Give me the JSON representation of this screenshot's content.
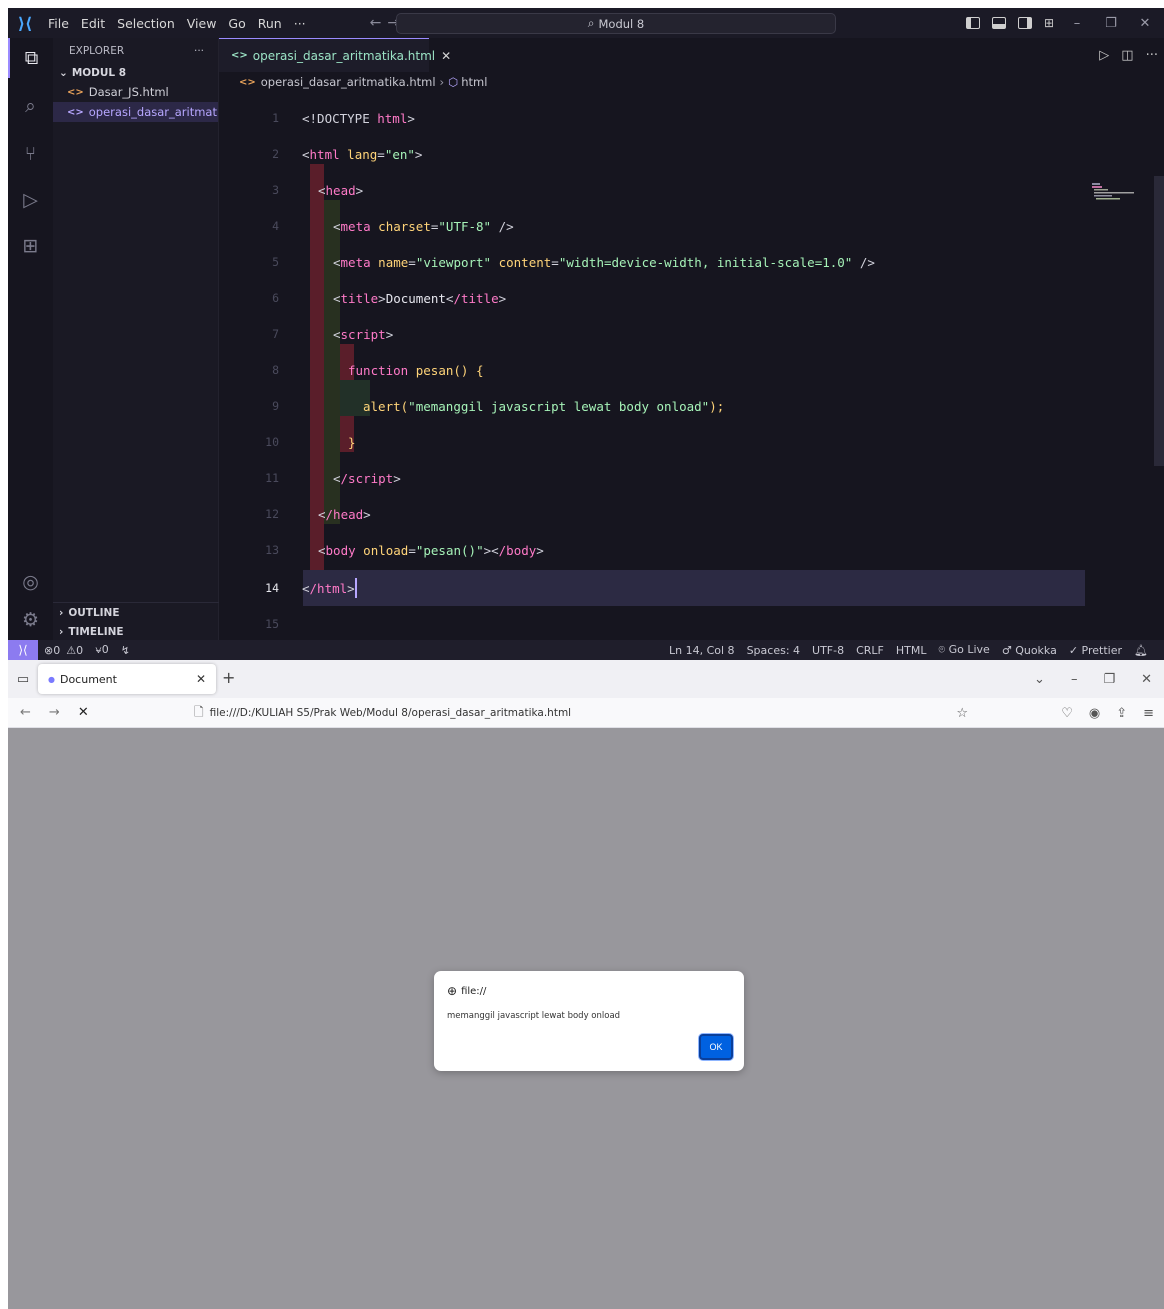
{
  "vscode": {
    "menu": [
      "File",
      "Edit",
      "Selection",
      "View",
      "Go",
      "Run",
      "···"
    ],
    "command_center": "Modul 8",
    "explorer": {
      "title": "EXPLORER",
      "more": "···",
      "folder": "MODUL 8",
      "files": [
        "Dasar_JS.html",
        "operasi_dasar_aritmatik..."
      ],
      "outline": "OUTLINE",
      "timeline": "TIMELINE"
    },
    "tab": {
      "label": "operasi_dasar_aritmatika.html"
    },
    "breadcrumb": {
      "file": "operasi_dasar_aritmatika.html",
      "symbol": "html"
    },
    "line_numbers": [
      "1",
      "2",
      "3",
      "4",
      "5",
      "6",
      "7",
      "8",
      "9",
      "10",
      "11",
      "12",
      "13",
      "14",
      "15"
    ],
    "code": {
      "l1_doctype": "<!DOCTYPE",
      "l1_html": " html",
      "l2_tag": "html",
      "l2_attr": " lang",
      "l2_val": "\"en\"",
      "l3_tag": "head",
      "l4_tag": "meta",
      "l4_attr": " charset",
      "l4_val": "\"UTF-8\"",
      "l5_tag": "meta",
      "l5_attr1": " name",
      "l5_val1": "\"viewport\"",
      "l5_attr2": " content",
      "l5_val2": "\"width=device-width, initial-scale=1.0\"",
      "l6_tag": "title",
      "l6_text": "Document",
      "l6_close": "/title",
      "l7_tag": "script",
      "l8_kw": "function",
      "l8_fn": " pesan",
      "l8_rest": "() {",
      "l9_fn": "alert",
      "l9_str": "\"memanggil javascript lewat body onload\"",
      "l9_end": ");",
      "l10": "}",
      "l11_tag": "/script",
      "l12_tag": "/head",
      "l13_tag": "body",
      "l13_attr": " onload",
      "l13_val": "\"pesan()\"",
      "l13_close": "/body",
      "l14_tag": "/html"
    },
    "status": {
      "errors": "⊗0",
      "warnings": "⚠0",
      "ports": "⍱0",
      "position": "Ln 14, Col 8",
      "spaces": "Spaces: 4",
      "encoding": "UTF-8",
      "eol": "CRLF",
      "language": "HTML",
      "golive": "Go Live",
      "quokka": "Quokka",
      "prettier": "✓ Prettier"
    }
  },
  "browser": {
    "tab_title": "Document",
    "url": "file:///D:/KULIAH S5/Prak Web/Modul 8/operasi_dasar_aritmatika.html",
    "dialog": {
      "origin": "file://",
      "message": "memanggil javascript lewat body onload",
      "ok": "OK"
    }
  }
}
